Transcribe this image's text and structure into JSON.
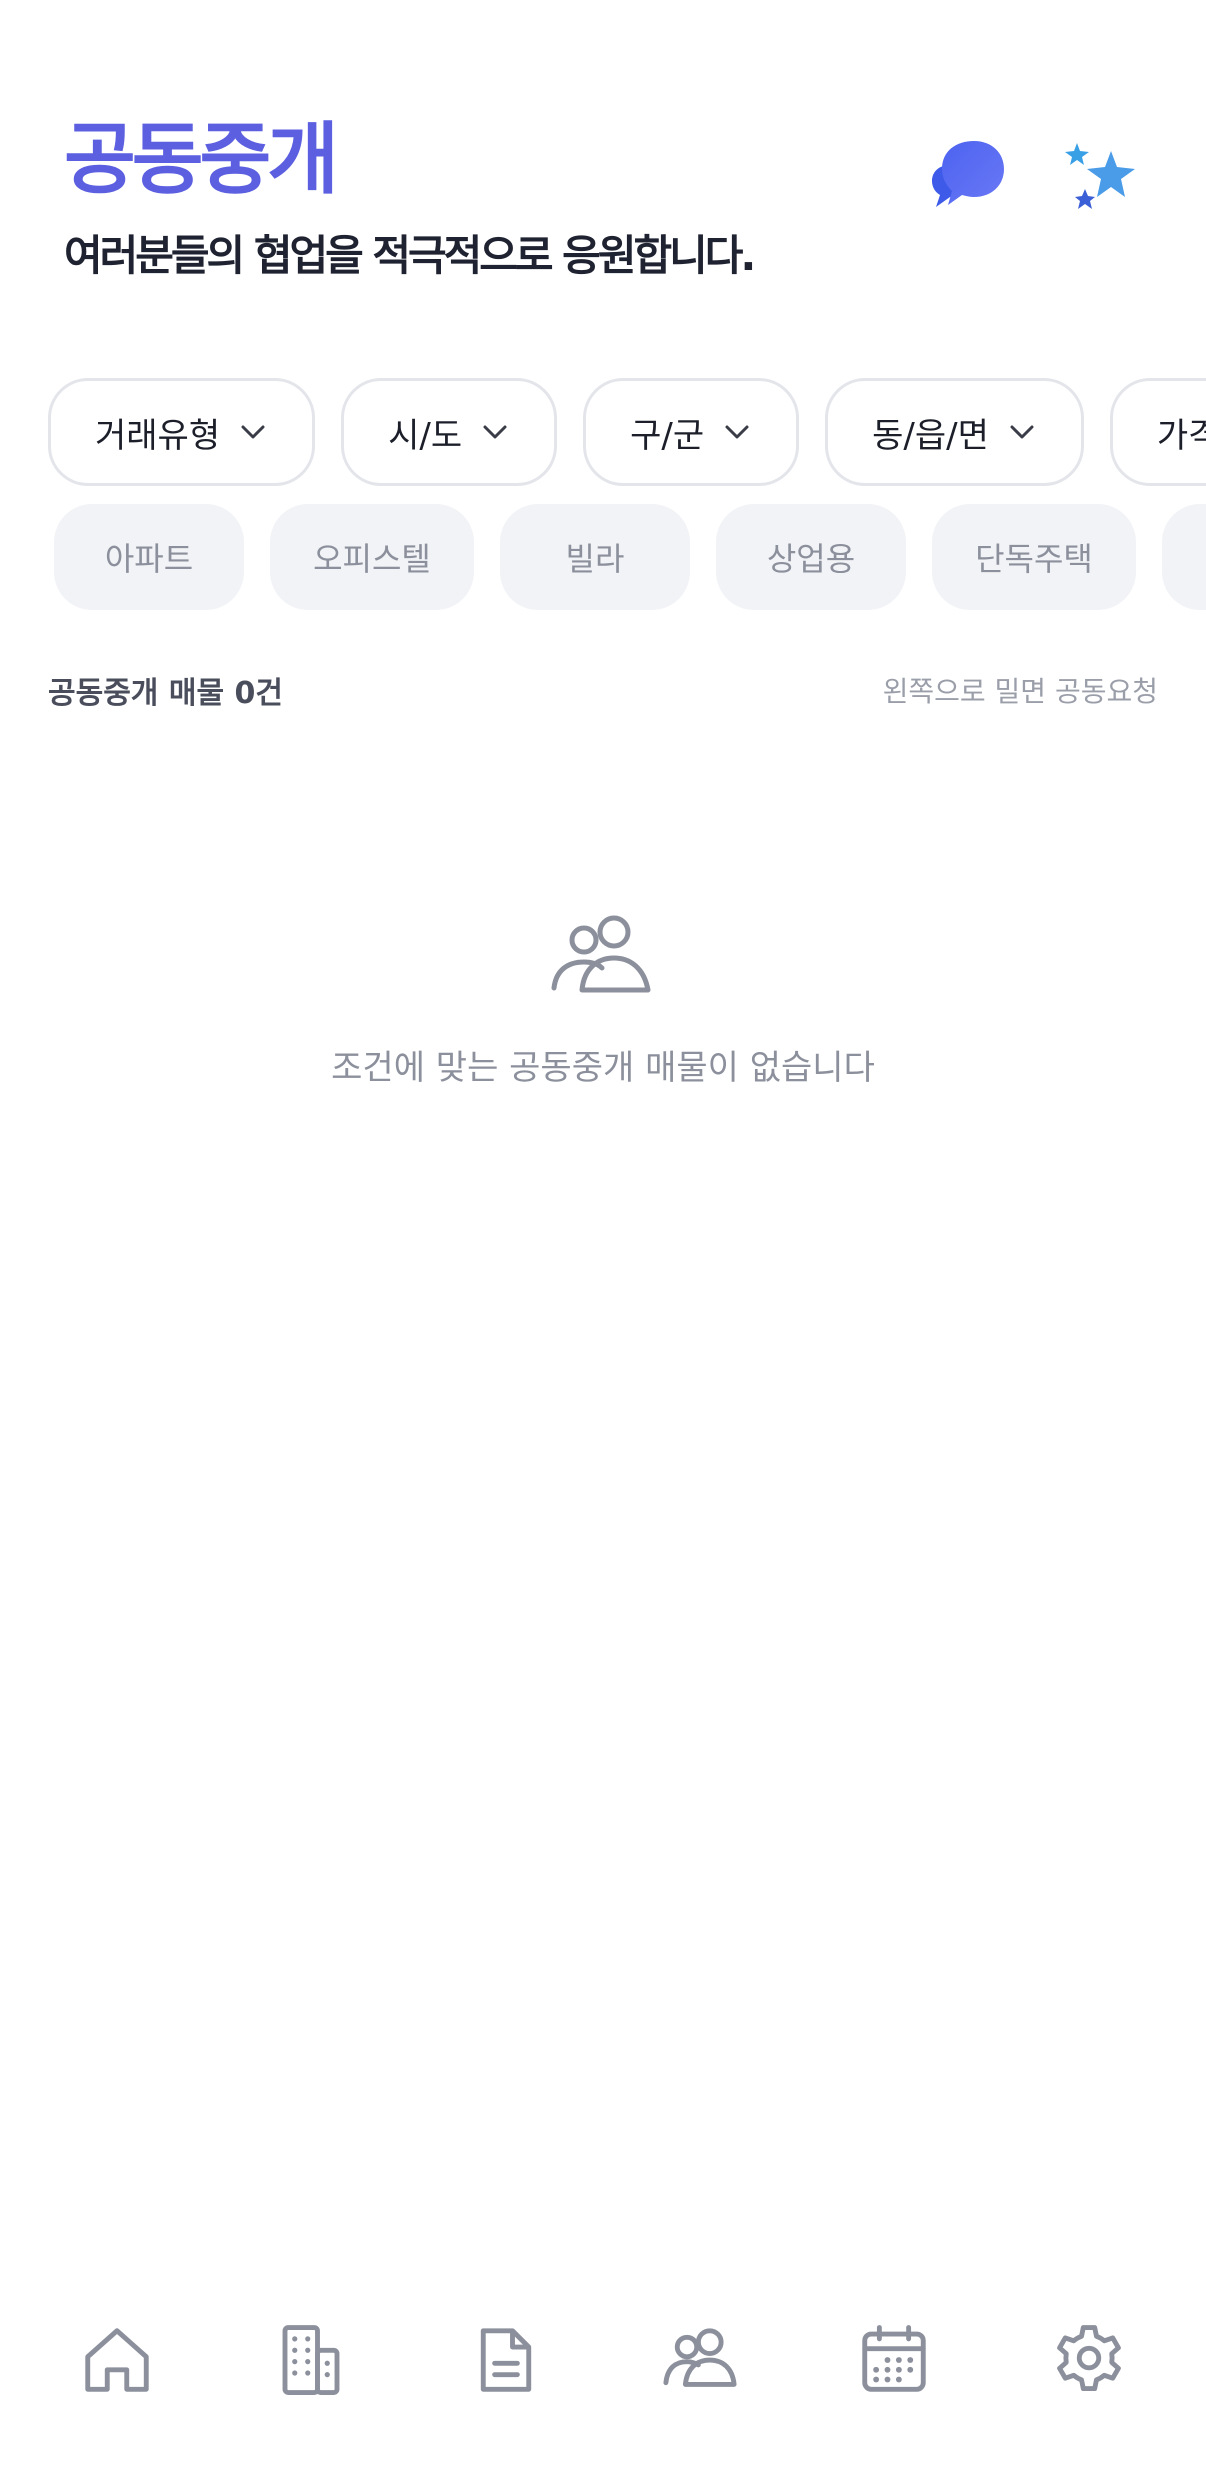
{
  "header": {
    "title": "공동중개",
    "subtitle": "여러분들의 협업을 적극적으로 응원합니다.",
    "icons": [
      "chat-bubble-icon",
      "sparkle-icon"
    ]
  },
  "filters": [
    {
      "label": "거래유형"
    },
    {
      "label": "시/도"
    },
    {
      "label": "구/군"
    },
    {
      "label": "동/읍/면"
    },
    {
      "label": "가격"
    }
  ],
  "property_types": [
    {
      "label": "아파트"
    },
    {
      "label": "오피스텔"
    },
    {
      "label": "빌라"
    },
    {
      "label": "상업용"
    },
    {
      "label": "단독주택"
    },
    {
      "label": ""
    }
  ],
  "listing": {
    "count_label": "공동중개 매물 0건",
    "hint": "왼쪽으로 밀면 공동요청"
  },
  "empty_state": {
    "icon": "users-icon",
    "message": "조건에 맞는 공동중개 매물이 없습니다"
  },
  "bottom_nav": {
    "items": [
      "home-icon",
      "building-icon",
      "document-icon",
      "users-icon",
      "calendar-icon",
      "gear-icon"
    ]
  },
  "colors": {
    "accent": "#5b5fe0",
    "chip_border": "#e3e5ea",
    "chip_bg": "#f2f3f6",
    "icon_gray": "#8c909c"
  }
}
